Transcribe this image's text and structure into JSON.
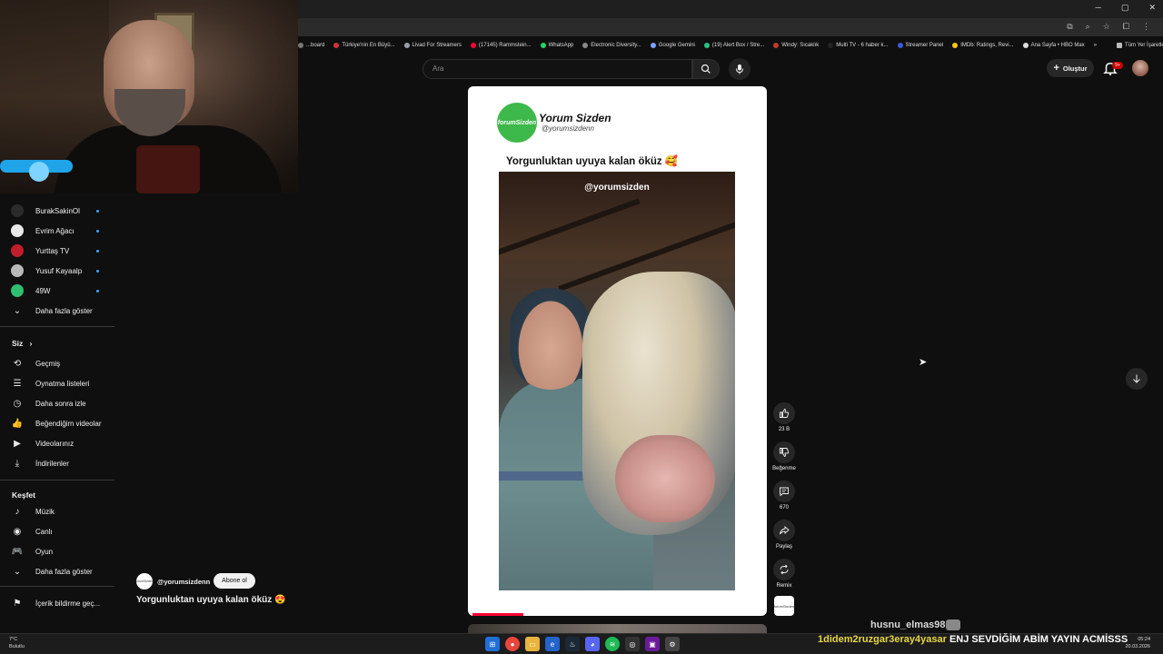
{
  "browser": {
    "bookmarks": [
      {
        "label": "...board",
        "color": "#777777"
      },
      {
        "label": "Türkiye'nin En Büyü...",
        "color": "#d33333"
      },
      {
        "label": "Livad For Streamers",
        "color": "#9aa0a6"
      },
      {
        "label": "(17145) Rammstein...",
        "color": "#ff0033"
      },
      {
        "label": "WhatsApp",
        "color": "#25d366"
      },
      {
        "label": "Electronic Diversity...",
        "color": "#888888"
      },
      {
        "label": "Google Gemini",
        "color": "#7aa2ff"
      },
      {
        "label": "(19) Alert Box / Stre...",
        "color": "#26c281"
      },
      {
        "label": "Windy: Sıcaklık",
        "color": "#c0392b"
      },
      {
        "label": "Multi TV - 6 haber k...",
        "color": "#222222"
      },
      {
        "label": "Streamer Panel",
        "color": "#3b5bdb"
      },
      {
        "label": "IMDb: Ratings, Revi...",
        "color": "#f5c518"
      },
      {
        "label": "Ana Sayfa • HBO Max",
        "color": "#dddddd"
      }
    ],
    "bookmarks_more": "»",
    "all_bookmarks": "Tüm Yer İşaretleri"
  },
  "sidebar": {
    "subscriptions": [
      {
        "label": "BurakSakinOl",
        "avatar_color": "#2b2b2b",
        "new": true
      },
      {
        "label": "Evrim Ağacı",
        "avatar_color": "#e8e8e8",
        "new": true
      },
      {
        "label": "Yurttaş TV",
        "avatar_color": "#c21d2a",
        "new": true
      },
      {
        "label": "Yusuf Kayaalp",
        "avatar_color": "#b9b9b9",
        "new": true
      },
      {
        "label": "49W",
        "avatar_color": "#2fbf71",
        "new": true
      }
    ],
    "show_more_1": "Daha fazla göster",
    "you_section": "Siz",
    "you_items": [
      {
        "label": "Geçmiş",
        "icon": "history-icon",
        "glyph": "⟲"
      },
      {
        "label": "Oynatma listeleri",
        "icon": "playlist-icon",
        "glyph": "☰"
      },
      {
        "label": "Daha sonra izle",
        "icon": "clock-icon",
        "glyph": "◷"
      },
      {
        "label": "Beğendiğim videolar",
        "icon": "thumbs-up-icon",
        "glyph": "👍"
      },
      {
        "label": "Videolarınız",
        "icon": "video-icon",
        "glyph": "▶"
      },
      {
        "label": "İndirilenler",
        "icon": "download-icon",
        "glyph": "⤓"
      }
    ],
    "explore_section": "Keşfet",
    "explore_items": [
      {
        "label": "Müzik",
        "icon": "music-icon",
        "glyph": "♪"
      },
      {
        "label": "Canlı",
        "icon": "live-icon",
        "glyph": "◉"
      },
      {
        "label": "Oyun",
        "icon": "gaming-icon",
        "glyph": "🎮"
      }
    ],
    "show_more_2": "Daha fazla göster",
    "report_history": "İçerik bildirme geç..."
  },
  "header": {
    "search_placeholder": "Ara",
    "create_label": "Oluştur",
    "notification_count": "9+"
  },
  "short": {
    "channel_logo_text": "forumSizden",
    "channel_title": "Yorum Sizden",
    "channel_handle": "@yorumsizdenn",
    "caption": "Yorgunluktan uyuya kalan öküz 🥰",
    "video_watermark": "@yorumsizden",
    "progress": 0.17
  },
  "actions": {
    "like_count": "23 B",
    "dislike_label": "Beğenme",
    "comment_count": "670",
    "share_label": "Paylaş",
    "remix_label": "Remix"
  },
  "channel_info": {
    "handle": "@yorumsizdenn",
    "subscribe_label": "Abone ol",
    "caption": "Yorgunluktan uyuya kalan öküz 😍"
  },
  "chat": {
    "username": "husnu_elmas98",
    "message_from": "1didem2ruzgar3eray4yasar",
    "message_text": "ENJ SEVDİĞİM ABİM YAYIN ACMİSSS"
  },
  "taskbar": {
    "temperature": "7°C",
    "weather": "Bulutlu",
    "time": "05:24",
    "date": "20.03.2026"
  }
}
